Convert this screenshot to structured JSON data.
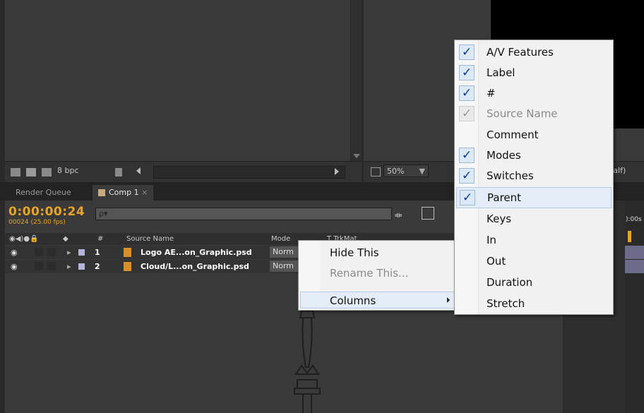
{
  "project_panel": {
    "bit_depth": "8 bpc",
    "icons": [
      "interpret-footage-icon",
      "folder-icon",
      "new-comp-icon",
      "trash-icon"
    ]
  },
  "viewer": {
    "zoom": "50%",
    "resolution": "Half)"
  },
  "tabs": [
    {
      "label": "Render Queue"
    },
    {
      "label": "Comp 1",
      "close": "×"
    }
  ],
  "timeline": {
    "timecode": "0:00:00:24",
    "frames_fps": "00024 (25.00 fps)",
    "search_placeholder": "ρ▾",
    "columns": {
      "hash": "#",
      "source_name": "Source Name",
      "mode": "Mode",
      "trkmat": "T  TrkMat"
    },
    "ruler_label": "):00s",
    "layers": [
      {
        "num": "1",
        "name": "Logo AE...on_Graphic.psd",
        "mode": "Norm"
      },
      {
        "num": "2",
        "name": "Cloud/L...on_Graphic.psd",
        "mode": "Norm"
      }
    ]
  },
  "context_menu": {
    "items": [
      {
        "label": "Hide This",
        "enabled": true
      },
      {
        "label": "Rename This...",
        "enabled": false
      },
      {
        "label": "Columns",
        "enabled": true,
        "submenu": true
      }
    ]
  },
  "columns_submenu": {
    "items": [
      {
        "label": "A/V Features",
        "checked": true
      },
      {
        "label": "Label",
        "checked": true
      },
      {
        "label": "#",
        "checked": true
      },
      {
        "label": "Source Name",
        "checked": true,
        "disabled": true
      },
      {
        "label": "Comment",
        "checked": false
      },
      {
        "label": "Modes",
        "checked": true
      },
      {
        "label": "Switches",
        "checked": true
      },
      {
        "label": "Parent",
        "checked": true,
        "hover": true
      },
      {
        "label": "Keys",
        "checked": false
      },
      {
        "label": "In",
        "checked": false
      },
      {
        "label": "Out",
        "checked": false
      },
      {
        "label": "Duration",
        "checked": false
      },
      {
        "label": "Stretch",
        "checked": false
      }
    ],
    "check_glyph": "✓"
  }
}
